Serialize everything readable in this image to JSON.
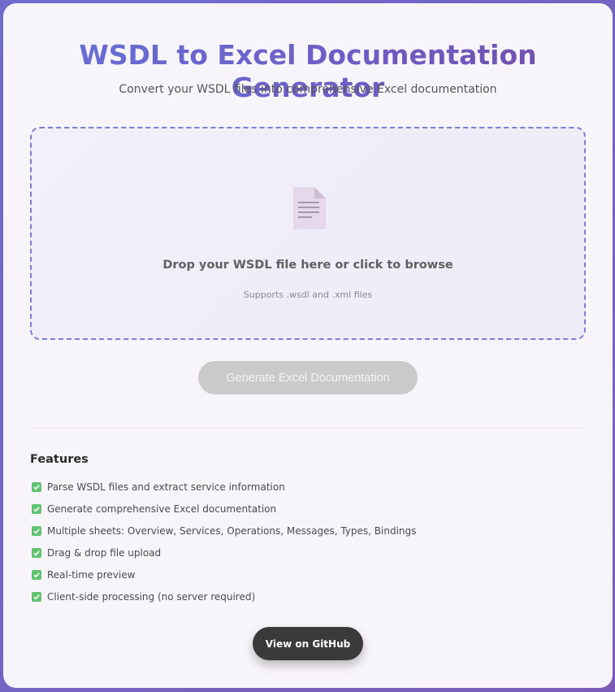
{
  "header": {
    "title": "WSDL to Excel Documentation Generator",
    "subtitle": "Convert your WSDL files into comprehensive Excel documentation"
  },
  "dropzone": {
    "icon": "document-icon",
    "primary_text": "Drop your WSDL file here or click to browse",
    "hint_text": "Supports .wsdl and .xml files"
  },
  "actions": {
    "generate_label": "Generate Excel Documentation",
    "generate_enabled": false,
    "github_label": "View on GitHub"
  },
  "features": {
    "heading": "Features",
    "items": [
      "Parse WSDL files and extract service information",
      "Generate comprehensive Excel documentation",
      "Multiple sheets: Overview, Services, Operations, Messages, Types, Bindings",
      "Drag & drop file upload",
      "Real-time preview",
      "Client-side processing (no server required)"
    ]
  },
  "colors": {
    "background_gradient_start": "#6f6ccc",
    "background_gradient_end": "#7a5cb8",
    "title_gradient_start": "#6672d8",
    "title_gradient_end": "#744ea8",
    "dropzone_border": "#7c80d4",
    "disabled_button": "#cbcaca",
    "check_green": "#5fc46f",
    "github_button": "#3a3a3a"
  }
}
